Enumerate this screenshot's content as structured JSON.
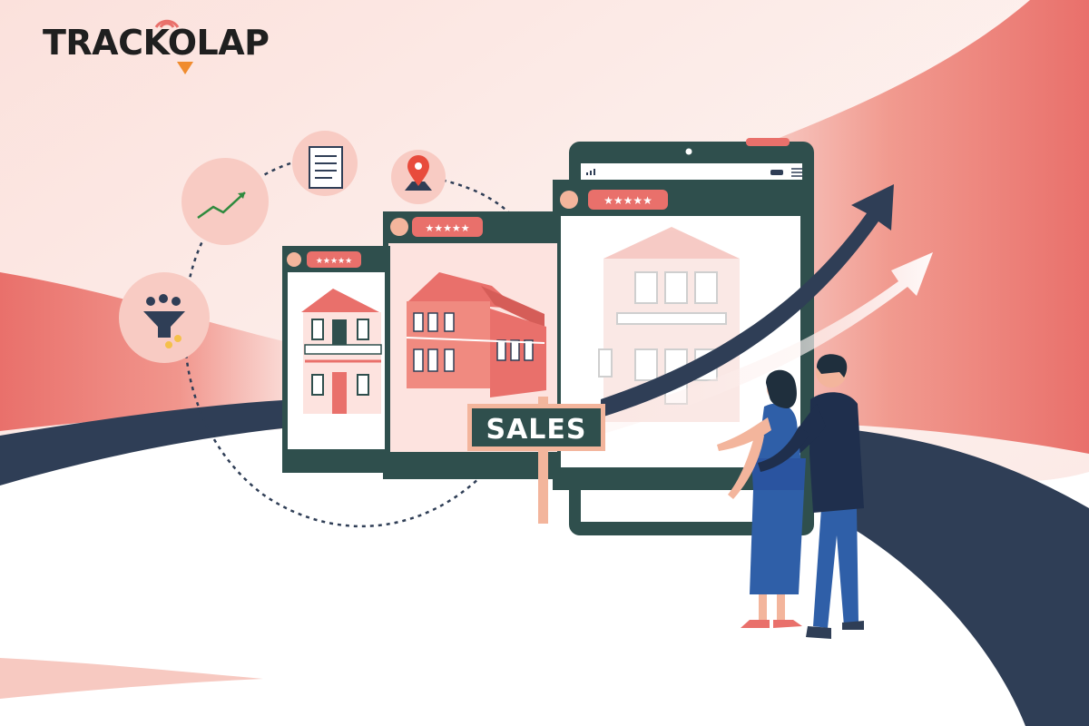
{
  "brand": {
    "logo_text": "TRACKOLAP"
  },
  "sign": {
    "label": "SALES"
  },
  "palette": {
    "coral": "#e9706b",
    "pale_pink": "#fbe3df",
    "navy": "#2f3e56",
    "dark_teal": "#2f4f4d",
    "blue_outfit": "#2f5fa8",
    "white": "#ffffff"
  },
  "icons": [
    "growth-chart-icon",
    "document-icon",
    "location-pin-icon",
    "sales-funnel-icon",
    "rating-stars-icon",
    "trend-arrow-icon"
  ]
}
